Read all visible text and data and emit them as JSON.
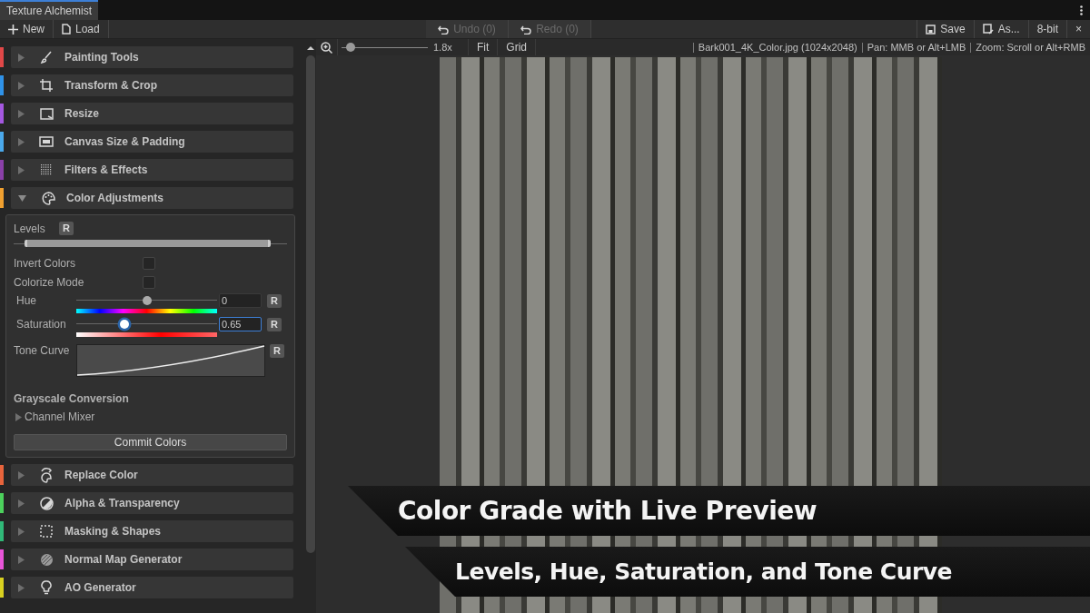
{
  "window": {
    "title": "Texture Alchemist"
  },
  "toolbar": {
    "left": [
      {
        "label": "New",
        "kind": "new"
      },
      {
        "label": "Load",
        "kind": "load"
      }
    ],
    "history": [
      {
        "label": "Undo (0)",
        "disabled": true
      },
      {
        "label": "Redo (0)",
        "disabled": true
      }
    ],
    "right": [
      {
        "label": "Save",
        "kind": "save"
      },
      {
        "label": "As...",
        "kind": "save_as"
      },
      {
        "label": "8-bit",
        "kind": "text"
      },
      {
        "label": "×",
        "kind": "text"
      }
    ]
  },
  "sections": [
    {
      "label": "Painting Tools",
      "color": "#e04848",
      "expanded": false
    },
    {
      "label": "Transform & Crop",
      "color": "#2f92e8",
      "expanded": false
    },
    {
      "label": "Resize",
      "color": "#a458e0",
      "expanded": false
    },
    {
      "label": "Canvas Size & Padding",
      "color": "#4aa8ea",
      "expanded": false
    },
    {
      "label": "Filters & Effects",
      "color": "#8a40a8",
      "expanded": false
    },
    {
      "label": "Color Adjustments",
      "color": "#f0a030",
      "expanded": true,
      "panel": {
        "levels": {
          "label": "Levels",
          "level": 0.94,
          "reset": "R"
        },
        "toggles": [
          {
            "label": "Invert Colors",
            "checked": false
          },
          {
            "label": "Colorize Mode",
            "checked": false
          }
        ],
        "sliders": [
          {
            "label": "Hue",
            "kind": "hue",
            "level": 0.5,
            "value": "0",
            "focused": false,
            "reset": "R"
          },
          {
            "label": "Saturation",
            "kind": "saturation",
            "level": 0.34,
            "value": "0.65",
            "focused": true,
            "reset": "R"
          }
        ],
        "tone_curve": {
          "label": "Tone Curve",
          "reset": "R"
        },
        "grayscale": {
          "title": "Grayscale Conversion",
          "items": [
            {
              "label": "Channel Mixer",
              "expanded": false
            }
          ]
        },
        "commit_button": "Commit Colors"
      }
    },
    {
      "label": "Replace Color",
      "color": "#e8643c",
      "expanded": false
    },
    {
      "label": "Alpha & Transparency",
      "color": "#4cd05c",
      "expanded": false
    },
    {
      "label": "Masking & Shapes",
      "color": "#30b878",
      "expanded": false
    },
    {
      "label": "Normal Map Generator",
      "color": "#e855d8",
      "expanded": false
    },
    {
      "label": "AO Generator",
      "color": "#d8d020",
      "expanded": false
    }
  ],
  "canvas": {
    "zoom": {
      "level": 0.1,
      "reading": "1.8x"
    },
    "buttons": [
      "Fit",
      "Grid"
    ],
    "info": [
      "Bark001_4K_Color.jpg (1024x2048)",
      "Pan: MMB or Alt+LMB",
      "Zoom: Scroll or Alt+RMB"
    ]
  },
  "captions": [
    "Color Grade with Live Preview",
    "Levels, Hue, Saturation, and Tone Curve"
  ]
}
